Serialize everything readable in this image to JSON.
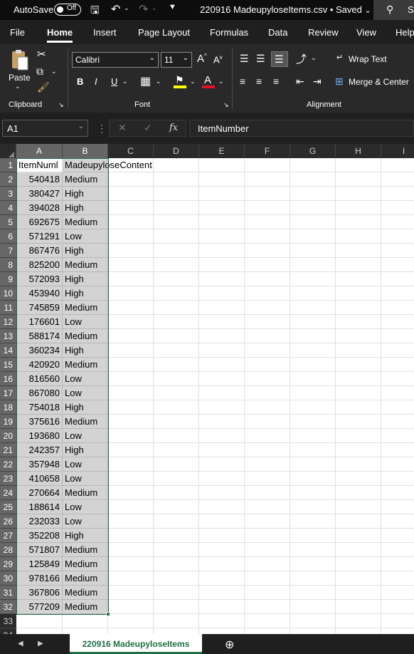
{
  "titlebar": {
    "autosave": "AutoSave",
    "toggle_state": "Off",
    "filename": "220916 MadeupyloseItems.csv",
    "status": "Saved",
    "search_stub": "Se"
  },
  "tabs": [
    {
      "label": "File"
    },
    {
      "label": "Home"
    },
    {
      "label": "Insert"
    },
    {
      "label": "Page Layout"
    },
    {
      "label": "Formulas"
    },
    {
      "label": "Data"
    },
    {
      "label": "Review"
    },
    {
      "label": "View"
    },
    {
      "label": "Help"
    }
  ],
  "ribbon": {
    "clipboard": {
      "group": "Clipboard",
      "paste": "Paste"
    },
    "font": {
      "group": "Font",
      "family": "Calibri",
      "size": "11",
      "grow": "A",
      "shrink": "A",
      "bold": "B",
      "italic": "I",
      "underline": "U",
      "font_color_letter": "A"
    },
    "alignment": {
      "group": "Alignment",
      "wrap_text": "Wrap Text",
      "merge_center": "Merge & Center"
    }
  },
  "formula_bar": {
    "name_box": "A1",
    "fx": "fx",
    "content": "ItemNumber"
  },
  "columns": [
    "A",
    "B",
    "C",
    "D",
    "E",
    "F",
    "G",
    "H",
    "I"
  ],
  "header_row": {
    "a": "ItemNuml",
    "b": "MadeupyloseContent"
  },
  "data_rows": [
    {
      "n": "2",
      "a": "540418",
      "b": "Medium"
    },
    {
      "n": "3",
      "a": "380427",
      "b": "High"
    },
    {
      "n": "4",
      "a": "394028",
      "b": "High"
    },
    {
      "n": "5",
      "a": "692675",
      "b": "Medium"
    },
    {
      "n": "6",
      "a": "571291",
      "b": "Low"
    },
    {
      "n": "7",
      "a": "867476",
      "b": "High"
    },
    {
      "n": "8",
      "a": "825200",
      "b": "Medium"
    },
    {
      "n": "9",
      "a": "572093",
      "b": "High"
    },
    {
      "n": "10",
      "a": "453940",
      "b": "High"
    },
    {
      "n": "11",
      "a": "745859",
      "b": "Medium"
    },
    {
      "n": "12",
      "a": "176601",
      "b": "Low"
    },
    {
      "n": "13",
      "a": "588174",
      "b": "Medium"
    },
    {
      "n": "14",
      "a": "360234",
      "b": "High"
    },
    {
      "n": "15",
      "a": "420920",
      "b": "Medium"
    },
    {
      "n": "16",
      "a": "816560",
      "b": "Low"
    },
    {
      "n": "17",
      "a": "867080",
      "b": "Low"
    },
    {
      "n": "18",
      "a": "754018",
      "b": "High"
    },
    {
      "n": "19",
      "a": "375616",
      "b": "Medium"
    },
    {
      "n": "20",
      "a": "193680",
      "b": "Low"
    },
    {
      "n": "21",
      "a": "242357",
      "b": "High"
    },
    {
      "n": "22",
      "a": "357948",
      "b": "Low"
    },
    {
      "n": "23",
      "a": "410658",
      "b": "Low"
    },
    {
      "n": "24",
      "a": "270664",
      "b": "Medium"
    },
    {
      "n": "25",
      "a": "188614",
      "b": "Low"
    },
    {
      "n": "26",
      "a": "232033",
      "b": "Low"
    },
    {
      "n": "27",
      "a": "352208",
      "b": "High"
    },
    {
      "n": "28",
      "a": "571807",
      "b": "Medium"
    },
    {
      "n": "29",
      "a": "125849",
      "b": "Medium"
    },
    {
      "n": "30",
      "a": "978166",
      "b": "Medium"
    },
    {
      "n": "31",
      "a": "367806",
      "b": "Medium"
    },
    {
      "n": "32",
      "a": "577209",
      "b": "Medium"
    }
  ],
  "trailing_rows": [
    "33",
    "34"
  ],
  "sheet_tab": "220916 MadeupyloseItems",
  "colors": {
    "accent_green": "#1e7145",
    "selection_gray": "#d3d3d3"
  }
}
